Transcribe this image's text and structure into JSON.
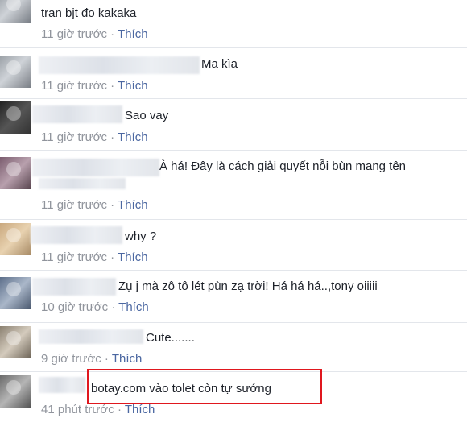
{
  "comments": [
    {
      "text": "tran bjt đo kakaka",
      "time": "11 giờ trước",
      "like": "Thích"
    },
    {
      "text": "Ma kìa",
      "time": "11 giờ trước",
      "like": "Thích"
    },
    {
      "text": "Sao vay",
      "time": "11 giờ trước",
      "like": "Thích"
    },
    {
      "text": "À há! Đây là cách giải quyết nỗi bùn mang tên",
      "time": "11 giờ trước",
      "like": "Thích"
    },
    {
      "text": "why ?",
      "time": "11 giờ trước",
      "like": "Thích"
    },
    {
      "text": "Zụ j mà zô tô lét pùn zạ trời! Há há há..,tony oiiiii",
      "time": "10 giờ trước",
      "like": "Thích"
    },
    {
      "text": "Cute.......",
      "time": "9 giờ trước",
      "like": "Thích"
    },
    {
      "text": "botay.com vào tolet còn tự sướng",
      "time": "41 phút trước",
      "like": "Thích"
    }
  ],
  "separator": "·",
  "colors": {
    "link": "#4b67a1",
    "meta": "#90949c",
    "highlight": "#e0171e"
  }
}
